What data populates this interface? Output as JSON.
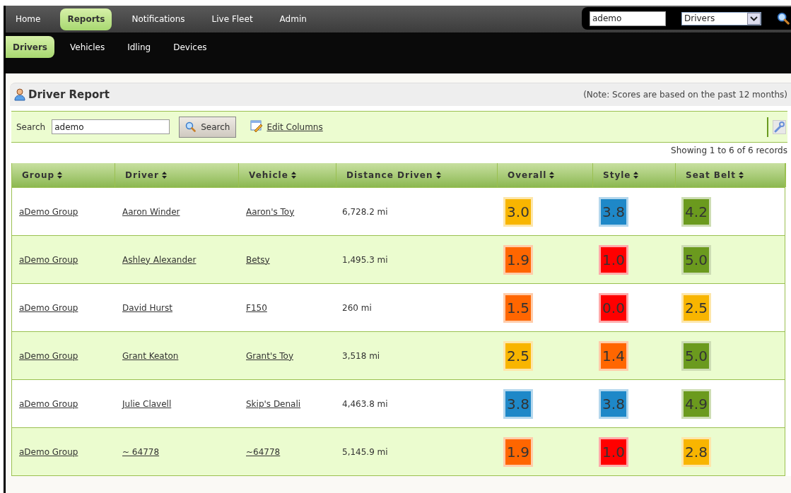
{
  "top_nav": [
    {
      "label": "Home",
      "selected": false
    },
    {
      "label": "Reports",
      "selected": true
    },
    {
      "label": "Notifications",
      "selected": false
    },
    {
      "label": "Live Fleet",
      "selected": false
    },
    {
      "label": "Admin",
      "selected": false
    }
  ],
  "quick_search": {
    "value": "ademo",
    "type_select": "Drivers"
  },
  "sub_nav": [
    {
      "label": "Drivers",
      "selected": true
    },
    {
      "label": "Vehicles",
      "selected": false
    },
    {
      "label": "Idling",
      "selected": false
    },
    {
      "label": "Devices",
      "selected": false
    }
  ],
  "panel": {
    "title": "Driver Report",
    "note": "(Note: Scores are based on the past 12 months)"
  },
  "toolbar": {
    "search_label": "Search",
    "search_value": "ademo",
    "search_button": "Search",
    "edit_columns": "Edit Columns"
  },
  "record_count": "Showing 1 to 6 of 6 records",
  "table": {
    "columns": [
      "Group",
      "Driver",
      "Vehicle",
      "Distance Driven",
      "Overall",
      "Style",
      "Seat Belt"
    ],
    "rows": [
      {
        "group": "aDemo Group",
        "driver": "Aaron Winder",
        "vehicle": "Aaron's Toy",
        "distance": "6,728.2 mi",
        "scores": [
          {
            "value": "3.0",
            "color": "#f8b500"
          },
          {
            "value": "3.8",
            "color": "#1e88c8"
          },
          {
            "value": "4.2",
            "color": "#6b9a1e"
          }
        ]
      },
      {
        "group": "aDemo Group",
        "driver": "Ashley Alexander",
        "vehicle": "Betsy",
        "distance": "1,495.3 mi",
        "scores": [
          {
            "value": "1.9",
            "color": "#ff6600"
          },
          {
            "value": "1.0",
            "color": "#ff0000"
          },
          {
            "value": "5.0",
            "color": "#6b9a1e"
          }
        ]
      },
      {
        "group": "aDemo Group",
        "driver": "David Hurst",
        "vehicle": "F150",
        "distance": "260 mi",
        "scores": [
          {
            "value": "1.5",
            "color": "#ff6600"
          },
          {
            "value": "0.0",
            "color": "#ff0000"
          },
          {
            "value": "2.5",
            "color": "#f8b500"
          }
        ]
      },
      {
        "group": "aDemo Group",
        "driver": "Grant Keaton",
        "vehicle": "Grant's Toy",
        "distance": "3,518 mi",
        "scores": [
          {
            "value": "2.5",
            "color": "#f8b500"
          },
          {
            "value": "1.4",
            "color": "#ff6600"
          },
          {
            "value": "5.0",
            "color": "#6b9a1e"
          }
        ]
      },
      {
        "group": "aDemo Group",
        "driver": "Julie Clavell",
        "vehicle": "Skip's Denali",
        "distance": "4,463.8 mi",
        "scores": [
          {
            "value": "3.8",
            "color": "#1e88c8"
          },
          {
            "value": "3.8",
            "color": "#1e88c8"
          },
          {
            "value": "4.9",
            "color": "#6b9a1e"
          }
        ]
      },
      {
        "group": "aDemo Group",
        "driver": "~ 64778",
        "vehicle": "~64778",
        "distance": "5,145.9 mi",
        "scores": [
          {
            "value": "1.9",
            "color": "#ff6600"
          },
          {
            "value": "1.0",
            "color": "#ff0000"
          },
          {
            "value": "2.8",
            "color": "#f8b500"
          }
        ]
      }
    ]
  }
}
